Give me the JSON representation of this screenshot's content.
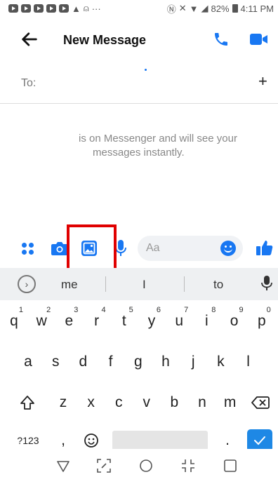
{
  "status_bar": {
    "battery": "82%",
    "time": "4:11 PM"
  },
  "header": {
    "title": "New Message"
  },
  "to_row": {
    "label": "To:"
  },
  "info": {
    "line1": "is on Messenger and will see your",
    "line2": "messages instantly."
  },
  "composer": {
    "placeholder": "Aa",
    "accent": "#1877f2"
  },
  "keyboard": {
    "suggestions": [
      "me",
      "I",
      "to"
    ],
    "row1": [
      {
        "k": "q",
        "n": "1"
      },
      {
        "k": "w",
        "n": "2"
      },
      {
        "k": "e",
        "n": "3"
      },
      {
        "k": "r",
        "n": "4"
      },
      {
        "k": "t",
        "n": "5"
      },
      {
        "k": "y",
        "n": "6"
      },
      {
        "k": "u",
        "n": "7"
      },
      {
        "k": "i",
        "n": "8"
      },
      {
        "k": "o",
        "n": "9"
      },
      {
        "k": "p",
        "n": "0"
      }
    ],
    "row2": [
      "a",
      "s",
      "d",
      "f",
      "g",
      "h",
      "j",
      "k",
      "l"
    ],
    "row3": [
      "z",
      "x",
      "c",
      "v",
      "b",
      "n",
      "m"
    ],
    "symbols_label": "?123",
    "comma": ",",
    "period": ".",
    "enter_accent": "#1e88e5"
  }
}
